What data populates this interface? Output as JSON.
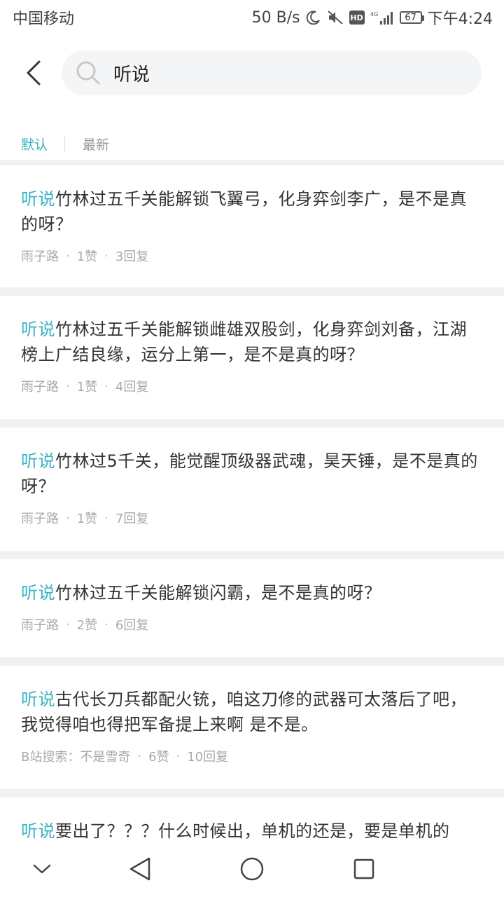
{
  "status_bar": {
    "carrier": "中国移动",
    "speed": "50 B/s",
    "network": "4G",
    "battery": "67",
    "time": "下午4:24"
  },
  "search": {
    "value": "听说",
    "placeholder": ""
  },
  "tabs": [
    {
      "label": "默认",
      "active": true
    },
    {
      "label": "最新",
      "active": false
    }
  ],
  "accent_color": "#3bb3c3",
  "results": [
    {
      "keyword": "听说",
      "title": "竹林过五千关能解锁飞翼弓，化身弈剑李广，是不是真的呀？",
      "author": "雨子路",
      "likes": "1赞",
      "replies": "3回复"
    },
    {
      "keyword": "听说",
      "title": "竹林过五千关能解锁雌雄双股剑，化身弈剑刘备，江湖榜上广结良缘，运分上第一，是不是真的呀？",
      "author": "雨子路",
      "likes": "1赞",
      "replies": "4回复"
    },
    {
      "keyword": "听说",
      "title": "竹林过5千关，能觉醒顶级器武魂，昊天锤，是不是真的呀？",
      "author": "雨子路",
      "likes": "1赞",
      "replies": "7回复"
    },
    {
      "keyword": "听说",
      "title": "竹林过五千关能解锁闪霸，是不是真的呀？",
      "author": "雨子路",
      "likes": "2赞",
      "replies": "6回复"
    },
    {
      "keyword": "听说",
      "title": "古代长刀兵都配火铳，咱这刀修的武器可太落后了吧，我觉得咱也得把军备提上来啊 是不是。",
      "author": "B站搜索：不是雪奇",
      "likes": "6赞",
      "replies": "10回复"
    },
    {
      "keyword": "听说",
      "title": "要出了？？？什么时候出，单机的还是，要是单机的",
      "author": "",
      "likes": "",
      "replies": ""
    }
  ],
  "nav": {
    "icons": [
      "chevron-down-icon",
      "back-triangle-icon",
      "home-circle-icon",
      "recents-square-icon"
    ]
  }
}
